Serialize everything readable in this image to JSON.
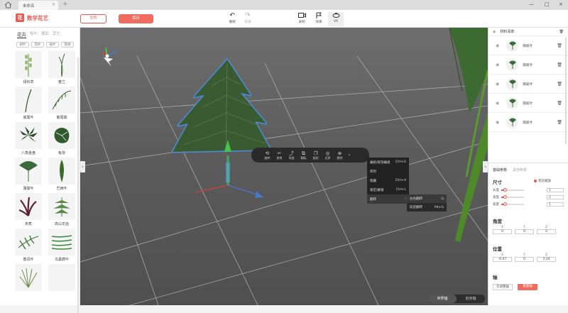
{
  "titlebar": {
    "tab_title": "未命名",
    "close": "×",
    "plus": "+",
    "min": "—",
    "max": "□",
    "win_close": "×"
  },
  "toolbar": {
    "logo_mark": "花",
    "app_name": "数学花艺",
    "file_label": "文件",
    "save_label": "保存",
    "undo_label": "撤销",
    "redo_label": "前进",
    "record_label": "录制",
    "effect_label": "效果",
    "vr_label": "VR"
  },
  "library": {
    "tabs": [
      "花卉",
      "枝叶",
      "器皿",
      "其它"
    ],
    "subtabs": [
      "树叶",
      "花叶",
      "枝叶",
      "其他"
    ],
    "items": [
      {
        "label": "绿铃草"
      },
      {
        "label": "春兰"
      },
      {
        "label": "底尾叶"
      },
      {
        "label": "散尾葵"
      },
      {
        "label": "八角金盘"
      },
      {
        "label": "龟背"
      },
      {
        "label": "蒲葵叶"
      },
      {
        "label": "巴西叶"
      },
      {
        "label": "朱蕉"
      },
      {
        "label": "高山羊齿"
      },
      {
        "label": "春羽叶"
      },
      {
        "label": "鸟巢蕨叶"
      }
    ]
  },
  "context_bar": {
    "items": [
      {
        "label": "旋转",
        "icon": "rotate-icon"
      },
      {
        "label": "修剪",
        "icon": "scissors-icon"
      },
      {
        "label": "弯曲",
        "icon": "bend-icon"
      },
      {
        "label": "翻転",
        "icon": "flip-icon"
      },
      {
        "label": "复制",
        "icon": "copy-icon"
      },
      {
        "label": "还原",
        "icon": "restore-icon"
      },
      {
        "label": "删除",
        "icon": "delete-icon"
      }
    ]
  },
  "context_menu": {
    "items": [
      {
        "label": "编组/取消编组",
        "shortcut": "Ctrl+G"
      },
      {
        "label": "阵列",
        "shortcut": ""
      },
      {
        "label": "隐藏",
        "shortcut": "Ctrl+H"
      },
      {
        "label": "锁定/解锁",
        "shortcut": "Ctrl+L"
      },
      {
        "label": "翻转",
        "shortcut": "›"
      }
    ],
    "submenu": [
      {
        "label": "左右翻转",
        "shortcut": "G"
      },
      {
        "label": "前后翻转",
        "shortcut": "Alt+G"
      }
    ]
  },
  "axis_toggle": {
    "world": "世界轴",
    "local": "自身轴"
  },
  "materials": {
    "title": "材料清单",
    "items": [
      {
        "label": "蒲葵叶"
      },
      {
        "label": "蒲葵叶"
      },
      {
        "label": "蒲葵叶"
      },
      {
        "label": "蒲葵叶"
      },
      {
        "label": "蒲葵叶"
      }
    ]
  },
  "properties": {
    "tab_basic": "基础参数",
    "tab_other": "其他参数",
    "size_title": "尺寸",
    "lock_ratio": "等比缩放",
    "sliders": [
      {
        "label": "长度",
        "value": "1"
      },
      {
        "label": "宽度",
        "value": "1"
      },
      {
        "label": "高度",
        "value": "1"
      }
    ],
    "angle_title": "角度",
    "angle": {
      "x": "0",
      "y": "0",
      "z": "0"
    },
    "position_title": "位置",
    "position": {
      "x": "-0.47",
      "y": "0",
      "z": "3.34"
    },
    "axis_title": "轴",
    "axis_btn1": "仅调整轴",
    "axis_btn2": "重置轴"
  },
  "colors": {
    "accent": "#e8584f",
    "viewport_bg": "#5a5a5a",
    "fern_outline": "#4a90e2"
  }
}
